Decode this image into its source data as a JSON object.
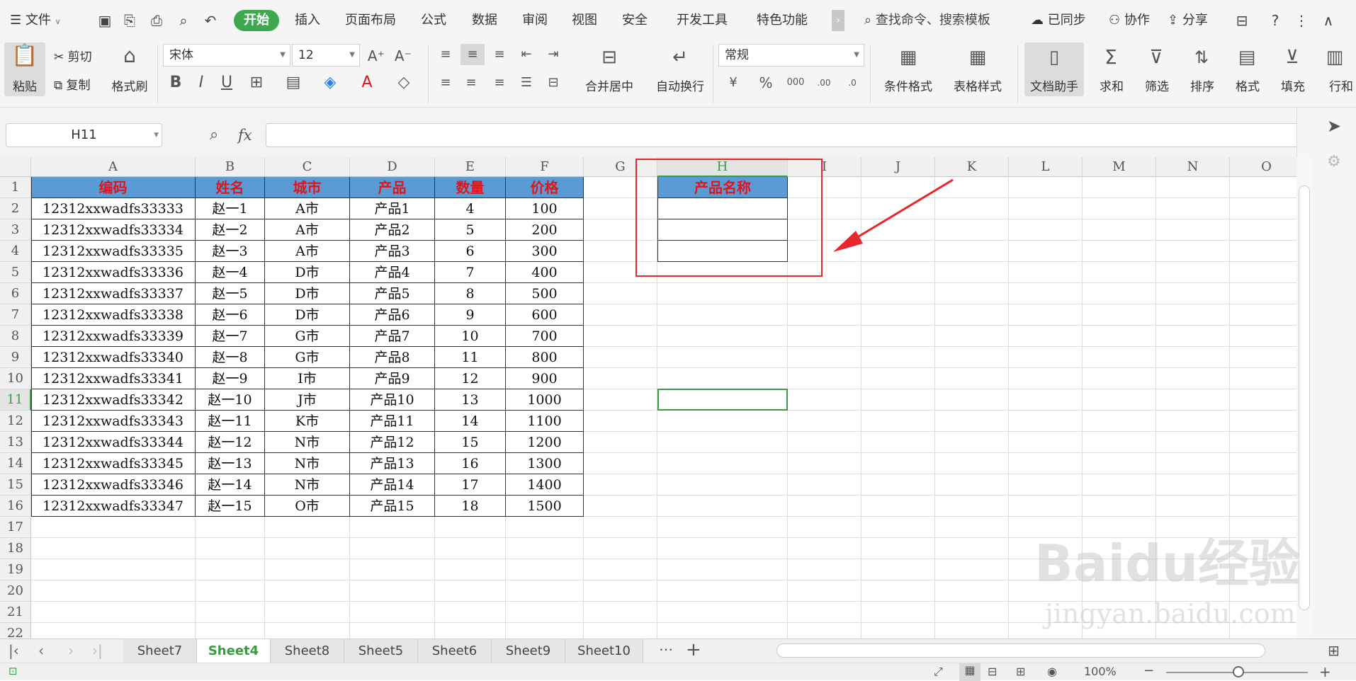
{
  "menubar": {
    "file_label": "文件",
    "tabs": [
      "开始",
      "插入",
      "页面布局",
      "公式",
      "数据",
      "审阅",
      "视图",
      "安全",
      "开发工具",
      "特色功能"
    ],
    "search_placeholder": "查找命令、搜索模板",
    "sync_label": "已同步",
    "collab_label": "协作",
    "share_label": "分享"
  },
  "ribbon": {
    "paste": "粘贴",
    "cut": "剪切",
    "copy": "复制",
    "format_painter": "格式刷",
    "font_name": "宋体",
    "font_size": "12",
    "merge_center": "合并居中",
    "wrap_text": "自动换行",
    "number_format": "常规",
    "cond_format": "条件格式",
    "table_style": "表格样式",
    "doc_assistant": "文档助手",
    "sum": "求和",
    "filter": "筛选",
    "sort": "排序",
    "format": "格式",
    "fill": "填充",
    "row_col": "行和"
  },
  "formula_bar": {
    "cell_ref": "H11",
    "fx_label": "fx",
    "content": ""
  },
  "columns": [
    "A",
    "B",
    "C",
    "D",
    "E",
    "F",
    "G",
    "H",
    "I",
    "J",
    "K",
    "L",
    "M",
    "N",
    "O"
  ],
  "rows": [
    "1",
    "2",
    "3",
    "4",
    "5",
    "6",
    "7",
    "8",
    "9",
    "10",
    "11",
    "12",
    "13",
    "14",
    "15",
    "16",
    "17",
    "18",
    "19",
    "20",
    "21",
    "22"
  ],
  "table": {
    "headers": [
      "编码",
      "姓名",
      "城市",
      "产品",
      "数量",
      "价格"
    ],
    "rows": [
      [
        "12312xxwadfs33333",
        "赵一1",
        "A市",
        "产品1",
        "4",
        "100"
      ],
      [
        "12312xxwadfs33334",
        "赵一2",
        "A市",
        "产品2",
        "5",
        "200"
      ],
      [
        "12312xxwadfs33335",
        "赵一3",
        "A市",
        "产品3",
        "6",
        "300"
      ],
      [
        "12312xxwadfs33336",
        "赵一4",
        "D市",
        "产品4",
        "7",
        "400"
      ],
      [
        "12312xxwadfs33337",
        "赵一5",
        "D市",
        "产品5",
        "8",
        "500"
      ],
      [
        "12312xxwadfs33338",
        "赵一6",
        "D市",
        "产品6",
        "9",
        "600"
      ],
      [
        "12312xxwadfs33339",
        "赵一7",
        "G市",
        "产品7",
        "10",
        "700"
      ],
      [
        "12312xxwadfs33340",
        "赵一8",
        "G市",
        "产品8",
        "11",
        "800"
      ],
      [
        "12312xxwadfs33341",
        "赵一9",
        "I市",
        "产品9",
        "12",
        "900"
      ],
      [
        "12312xxwadfs33342",
        "赵一10",
        "J市",
        "产品10",
        "13",
        "1000"
      ],
      [
        "12312xxwadfs33343",
        "赵一11",
        "K市",
        "产品11",
        "14",
        "1100"
      ],
      [
        "12312xxwadfs33344",
        "赵一12",
        "N市",
        "产品12",
        "15",
        "1200"
      ],
      [
        "12312xxwadfs33345",
        "赵一13",
        "N市",
        "产品13",
        "16",
        "1300"
      ],
      [
        "12312xxwadfs33346",
        "赵一14",
        "N市",
        "产品14",
        "17",
        "1400"
      ],
      [
        "12312xxwadfs33347",
        "赵一15",
        "O市",
        "产品15",
        "18",
        "1500"
      ]
    ]
  },
  "side_table": {
    "header": "产品名称"
  },
  "sheet_tabs": [
    "Sheet7",
    "Sheet4",
    "Sheet8",
    "Sheet5",
    "Sheet6",
    "Sheet9",
    "Sheet10"
  ],
  "active_sheet": "Sheet4",
  "status": {
    "zoom": "100%"
  },
  "watermark": {
    "main": "Baidu经验",
    "sub": "jingyan.baidu.com"
  },
  "colors": {
    "accent_green": "#3ea84f",
    "header_blue": "#5b9bd5",
    "header_red_text": "#e0151b",
    "annotation_red": "#e8262b"
  }
}
